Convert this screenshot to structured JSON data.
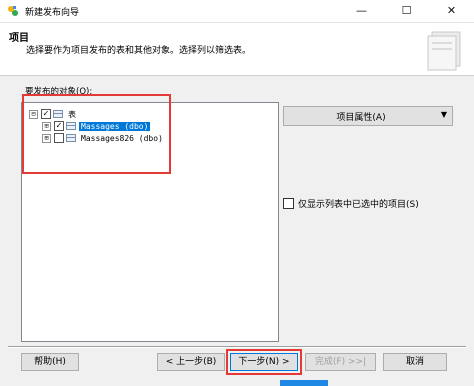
{
  "window": {
    "title": "新建发布向导",
    "controls": {
      "minimize": "—",
      "maximize": "☐",
      "close": "✕"
    }
  },
  "header": {
    "title": "项目",
    "description": "选择要作为项目发布的表和其他对象。选择列以筛选表。"
  },
  "objects": {
    "label": "要发布的对象(O):",
    "root": {
      "expander": "⊟",
      "checked": true,
      "label": "表"
    },
    "children": [
      {
        "expander": "⊞",
        "checked": true,
        "label": "Massages (dbo)",
        "selected": true
      },
      {
        "expander": "⊞",
        "checked": false,
        "label": "Massages826 (dbo)",
        "selected": false
      }
    ]
  },
  "properties_button": {
    "label": "项目属性(A)",
    "arrow": "▼"
  },
  "filter_checkbox": {
    "checked": false,
    "label": "仅显示列表中已选中的项目(S)"
  },
  "buttons": {
    "help": "帮助(H)",
    "back": "< 上一步(B)",
    "next": "下一步(N) >",
    "finish": "完成(F) >>|",
    "cancel": "取消"
  },
  "colors": {
    "highlight": "#e53935",
    "selection": "#0078d7",
    "accent": "#1e88e5"
  }
}
